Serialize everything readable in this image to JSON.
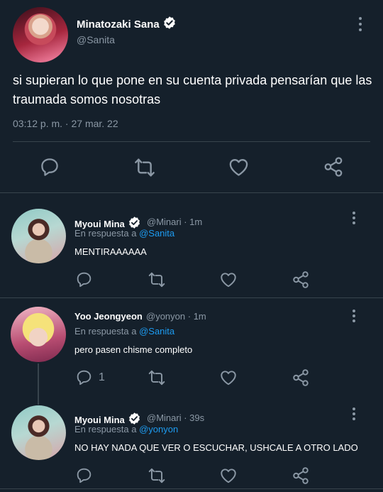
{
  "main_tweet": {
    "display_name": "Minatozaki Sana",
    "handle": "@Sanita",
    "text_line1": "si supieran lo que pone en su cuenta privada pensarían que las",
    "text_line2": "traumada somos nosotras",
    "timestamp": "03:12 p. m. · 27 mar. 22"
  },
  "replies": [
    {
      "display_name": "Myoui Mina",
      "handle": "@Minari",
      "time": "· 1m",
      "reply_prefix": "En respuesta a",
      "reply_to": "@Sanita",
      "text": "MENTIRAAAAAA",
      "reply_count": ""
    },
    {
      "display_name": "Yoo Jeongyeon",
      "handle": "@yonyon",
      "time": "· 1m",
      "reply_prefix": "En respuesta a",
      "reply_to": "@Sanita",
      "text": "pero pasen chisme completo",
      "reply_count": "1"
    },
    {
      "display_name": "Myoui Mina",
      "handle": "@Minari",
      "time": "· 39s",
      "reply_prefix": "En respuesta a",
      "reply_to": "@yonyon",
      "text": "NO HAY NADA QUE VER O ESCUCHAR, USHCALE A OTRO LADO",
      "reply_count": ""
    }
  ],
  "icons": [
    "verified-badge-icon",
    "more-options-icon",
    "reply-icon",
    "retweet-icon",
    "like-icon",
    "share-icon"
  ],
  "colors": {
    "background": "#15202b",
    "text": "#ffffff",
    "muted": "#8b98a5",
    "link": "#1d9bf0",
    "divider": "#38444d"
  }
}
